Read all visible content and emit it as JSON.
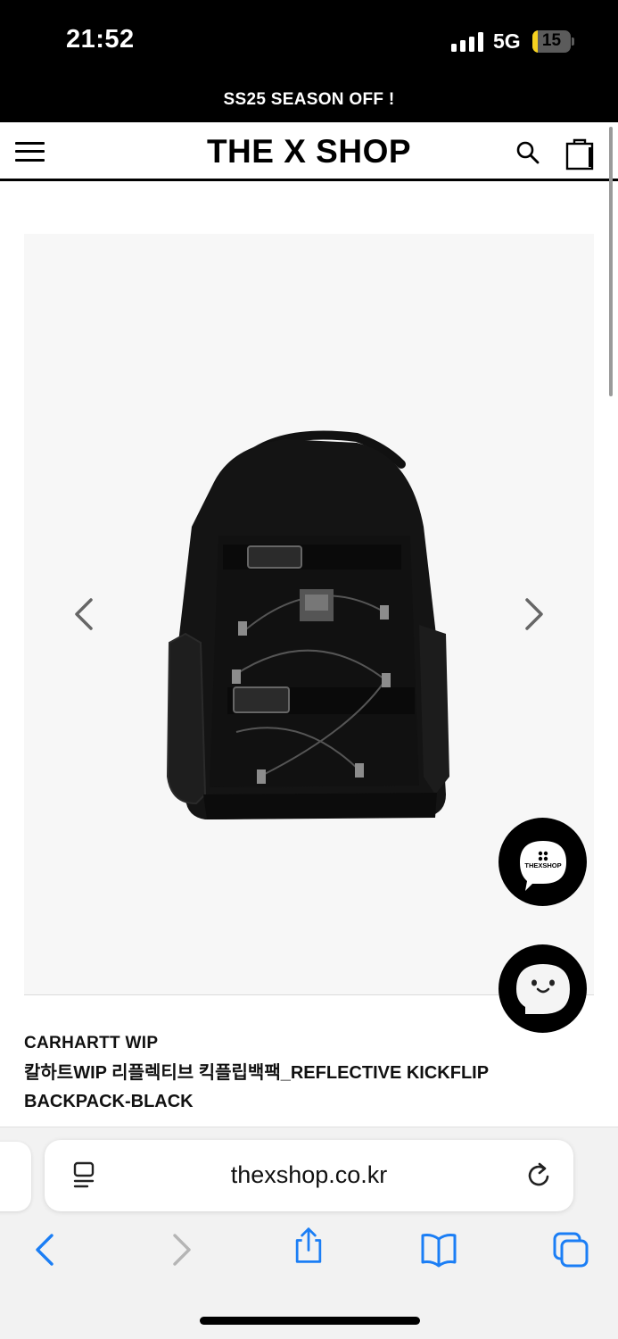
{
  "status_bar": {
    "time": "21:52",
    "network": "5G",
    "battery_level": "15",
    "battery_fraction": 0.15,
    "battery_color": "#f6d11f"
  },
  "promo": {
    "text": "SS25 SEASON OFF !"
  },
  "header": {
    "logo": "THE X SHOP",
    "menu_icon": "hamburger-menu-icon",
    "search_icon": "search-icon",
    "cart_icon": "shopping-bag-icon"
  },
  "product": {
    "image_icon": "backpack-image",
    "brand": "CARHARTT WIP",
    "name": "칼하트WIP 리플렉티브 킥플립백팩_REFLECTIVE KICKFLIP BACKPACK-BLACK",
    "prev_icon": "chevron-left-icon",
    "next_icon": "chevron-right-icon"
  },
  "chat": {
    "button1_label": "THEXSHOP",
    "button1_icon": "speech-bubble-icon",
    "button2_icon": "chatbot-face-icon"
  },
  "browser": {
    "url": "thexshop.co.kr",
    "reader_icon": "reader-mode-icon",
    "reload_icon": "reload-icon",
    "toolbar": {
      "back_icon": "back-chevron-icon",
      "forward_icon": "forward-chevron-icon",
      "share_icon": "share-icon",
      "bookmarks_icon": "bookmarks-book-icon",
      "tabs_icon": "tabs-icon"
    },
    "accent_color": "#1b7ef5"
  }
}
